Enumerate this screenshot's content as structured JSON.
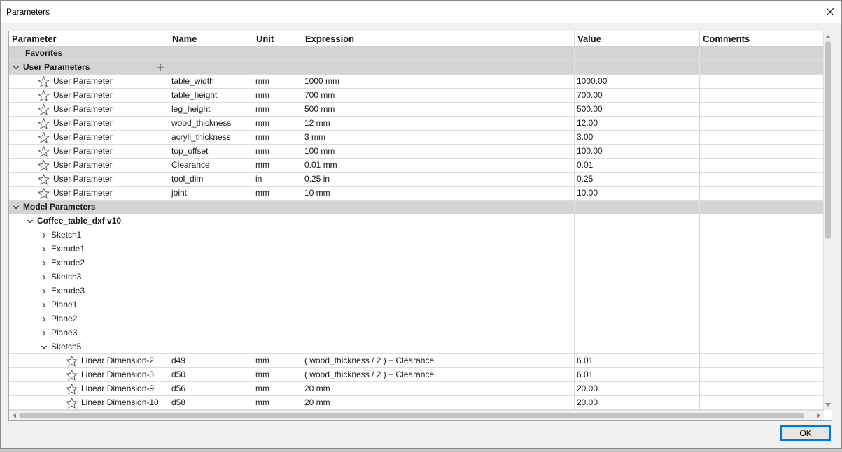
{
  "window": {
    "title": "Parameters",
    "close_label": "×"
  },
  "columns": [
    "Parameter",
    "Name",
    "Unit",
    "Expression",
    "Value",
    "Comments"
  ],
  "sections": {
    "favorites": "Favorites",
    "user_parameters": "User Parameters",
    "model_parameters": "Model Parameters"
  },
  "user_params": [
    {
      "type": "User Parameter",
      "name": "table_width",
      "unit": "mm",
      "expression": "1000 mm",
      "value": "1000.00",
      "comment": ""
    },
    {
      "type": "User Parameter",
      "name": "table_height",
      "unit": "mm",
      "expression": "700 mm",
      "value": "700.00",
      "comment": ""
    },
    {
      "type": "User Parameter",
      "name": "leg_height",
      "unit": "mm",
      "expression": "500 mm",
      "value": "500.00",
      "comment": ""
    },
    {
      "type": "User Parameter",
      "name": "wood_thickness",
      "unit": "mm",
      "expression": "12 mm",
      "value": "12.00",
      "comment": ""
    },
    {
      "type": "User Parameter",
      "name": "acryli_thickness",
      "unit": "mm",
      "expression": "3 mm",
      "value": "3.00",
      "comment": ""
    },
    {
      "type": "User Parameter",
      "name": "top_offset",
      "unit": "mm",
      "expression": "100 mm",
      "value": "100.00",
      "comment": ""
    },
    {
      "type": "User Parameter",
      "name": "Clearance",
      "unit": "mm",
      "expression": "0.01 mm",
      "value": "0.01",
      "comment": ""
    },
    {
      "type": "User Parameter",
      "name": "tool_dim",
      "unit": "in",
      "expression": "0.25 in",
      "value": "0.25",
      "comment": ""
    },
    {
      "type": "User Parameter",
      "name": "joint",
      "unit": "mm",
      "expression": "10 mm",
      "value": "10.00",
      "comment": ""
    }
  ],
  "model": {
    "component": "Coffee_table_dxf v10",
    "features": [
      "Sketch1",
      "Extrude1",
      "Extrude2",
      "Sketch3",
      "Extrude3",
      "Plane1",
      "Plane2",
      "Plane3",
      "Sketch5"
    ],
    "sketch5_params": [
      {
        "type": "Linear Dimension-2",
        "name": "d49",
        "unit": "mm",
        "expression": "( wood_thickness / 2 ) + Clearance",
        "value": "6.01"
      },
      {
        "type": "Linear Dimension-3",
        "name": "d50",
        "unit": "mm",
        "expression": "( wood_thickness / 2 ) + Clearance",
        "value": "6.01"
      },
      {
        "type": "Linear Dimension-9",
        "name": "d56",
        "unit": "mm",
        "expression": "20 mm",
        "value": "20.00"
      },
      {
        "type": "Linear Dimension-10",
        "name": "d58",
        "unit": "mm",
        "expression": "20 mm",
        "value": "20.00"
      }
    ]
  },
  "buttons": {
    "ok": "OK"
  },
  "icons": {
    "star": "star-outline-icon",
    "expand": "chevron-down-icon",
    "collapse": "chevron-right-icon",
    "add": "plus-icon",
    "close": "close-icon"
  }
}
